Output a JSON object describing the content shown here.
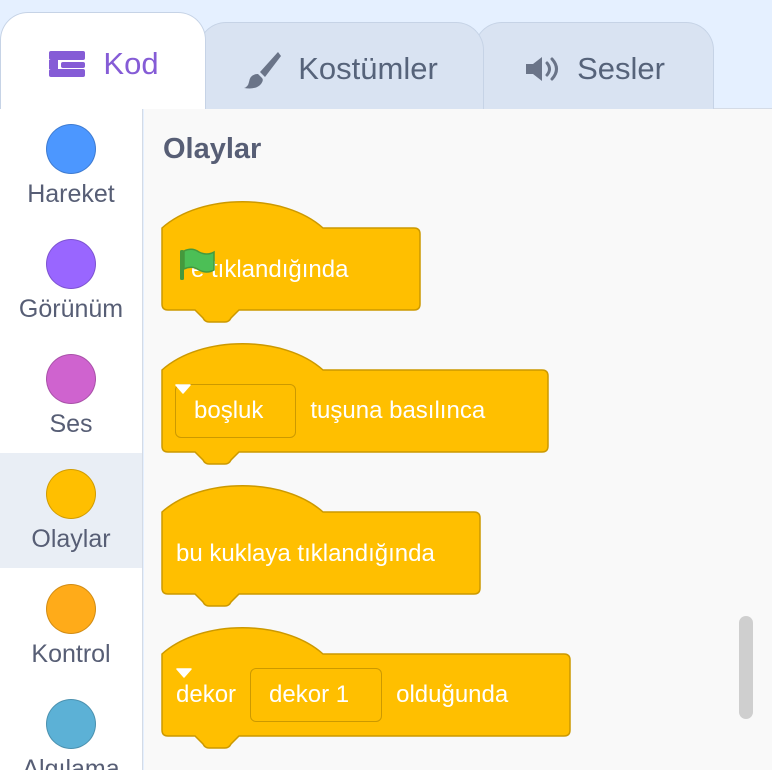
{
  "tabs": {
    "code": {
      "label": "Kod",
      "icon": "code-blocks-icon",
      "active": true
    },
    "costumes": {
      "label": "Kostümler",
      "icon": "paintbrush-icon"
    },
    "sounds": {
      "label": "Sesler",
      "icon": "speaker-icon"
    }
  },
  "categories": [
    {
      "label": "Hareket",
      "color": "#4c97ff"
    },
    {
      "label": "Görünüm",
      "color": "#9966ff"
    },
    {
      "label": "Ses",
      "color": "#cf63cf"
    },
    {
      "label": "Olaylar",
      "color": "#ffbf00",
      "selected": true
    },
    {
      "label": "Kontrol",
      "color": "#ffab19"
    },
    {
      "label": "Algılama",
      "color": "#5cb1d6"
    }
  ],
  "palette": {
    "title": "Olaylar",
    "blocks": {
      "flag_clicked": {
        "icon": "green-flag-icon",
        "text": "e tıklandığında"
      },
      "key_pressed": {
        "dropdown": "boşluk",
        "text": "tuşuna basılınca"
      },
      "sprite_clicked": {
        "text": "bu kuklaya tıklandığında"
      },
      "backdrop_switch": {
        "prefix": "dekor",
        "dropdown": "dekor 1",
        "text": "olduğunda"
      }
    }
  },
  "colors": {
    "events_fill": "#ffbf00",
    "events_border": "#cc9900",
    "accent": "#855cd6"
  }
}
